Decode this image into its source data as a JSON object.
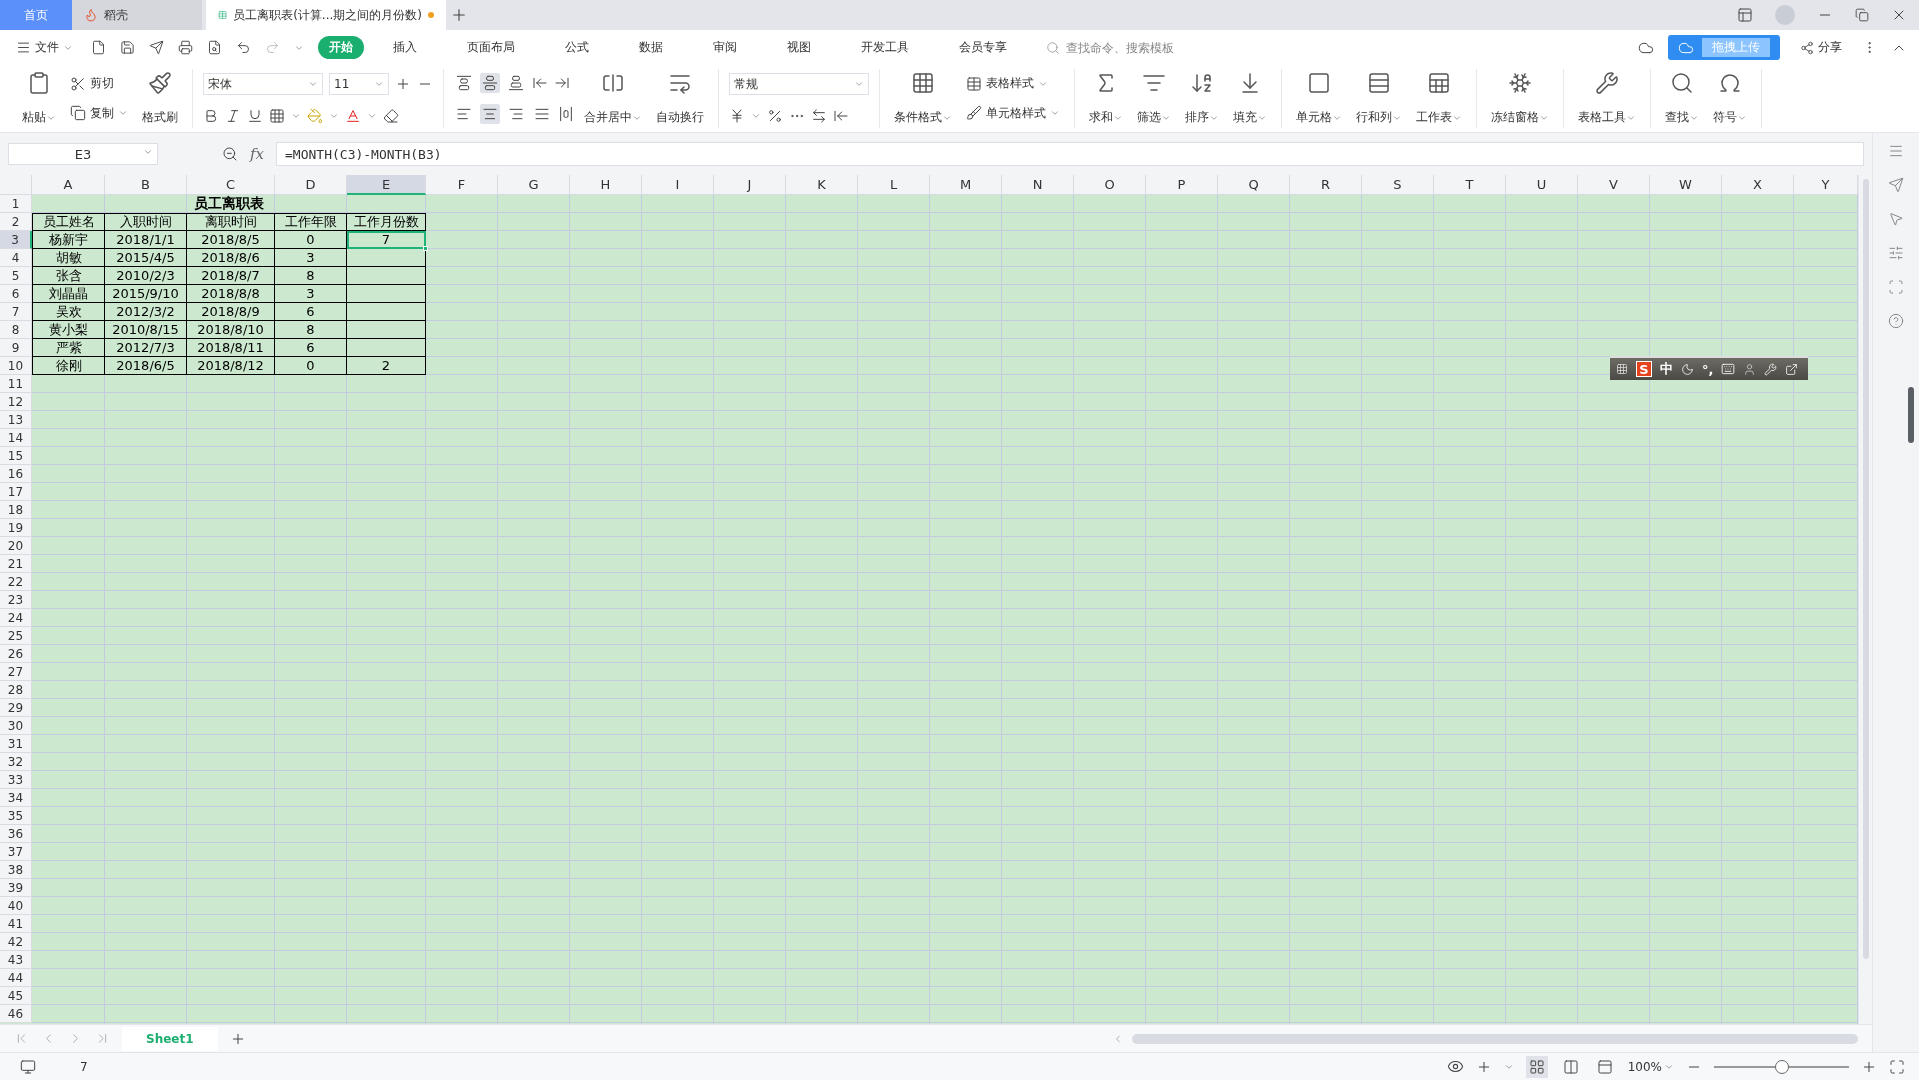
{
  "tabs": [
    {
      "label": "首页",
      "kind": "home",
      "selected": false
    },
    {
      "label": "稻壳",
      "kind": "docer",
      "selected": false
    },
    {
      "label": "员工离职表(计算...期之间的月份数)",
      "kind": "sheet",
      "selected": true,
      "modified": true
    }
  ],
  "menu": {
    "file": "文件",
    "tabs": [
      {
        "label": "开始",
        "selected": true
      },
      {
        "label": "插入",
        "selected": false
      },
      {
        "label": "页面布局",
        "selected": false
      },
      {
        "label": "公式",
        "selected": false
      },
      {
        "label": "数据",
        "selected": false
      },
      {
        "label": "审阅",
        "selected": false
      },
      {
        "label": "视图",
        "selected": false
      },
      {
        "label": "开发工具",
        "selected": false
      },
      {
        "label": "会员专享",
        "selected": false
      }
    ],
    "search": {
      "placeholder": "查找命令、搜索模板"
    },
    "upload": "拖拽上传",
    "share": "分享"
  },
  "ribbon": {
    "groups": [
      {
        "items": [
          {
            "kind": "large",
            "label": "粘贴",
            "dropdown": true
          },
          {
            "kind": "stack",
            "items": [
              {
                "label": "剪切",
                "dropdown": false
              },
              {
                "label": "复制",
                "dropdown": true
              }
            ]
          },
          {
            "kind": "large",
            "label": "格式刷",
            "dropdown": false
          }
        ]
      },
      {
        "items": [
          {
            "kind": "font",
            "font": "宋体",
            "size": "11"
          }
        ]
      },
      {
        "items": [
          {
            "kind": "alignment",
            "vertical": [
              {
                "selected": false
              },
              {
                "selected": true
              },
              {
                "selected": false
              }
            ],
            "horizontal": [
              {
                "selected": false
              },
              {
                "selected": true
              },
              {
                "selected": false
              },
              {
                "selected": false
              }
            ]
          },
          {
            "kind": "large",
            "label": "合并居中",
            "dropdown": true
          },
          {
            "kind": "large",
            "label": "自动换行",
            "dropdown": false
          }
        ]
      },
      {
        "items": [
          {
            "kind": "number",
            "format": "常规"
          }
        ]
      },
      {
        "items": [
          {
            "kind": "large",
            "label": "条件格式",
            "dropdown": true
          },
          {
            "kind": "stack",
            "items": [
              {
                "label": "表格样式",
                "dropdown": true
              },
              {
                "label": "单元格样式",
                "dropdown": true
              }
            ]
          }
        ]
      },
      {
        "items": [
          {
            "kind": "large",
            "label": "求和",
            "dropdown": true
          },
          {
            "kind": "large",
            "label": "筛选",
            "dropdown": true
          },
          {
            "kind": "large",
            "label": "排序",
            "dropdown": true
          },
          {
            "kind": "large",
            "label": "填充",
            "dropdown": true
          }
        ]
      },
      {
        "items": [
          {
            "kind": "large",
            "label": "单元格",
            "dropdown": true
          },
          {
            "kind": "large",
            "label": "行和列",
            "dropdown": true
          },
          {
            "kind": "large",
            "label": "工作表",
            "dropdown": true
          }
        ]
      },
      {
        "items": [
          {
            "kind": "large",
            "label": "冻结窗格",
            "dropdown": true
          }
        ]
      },
      {
        "items": [
          {
            "kind": "large",
            "label": "表格工具",
            "dropdown": true
          }
        ]
      },
      {
        "items": [
          {
            "kind": "large",
            "label": "查找",
            "dropdown": true
          },
          {
            "kind": "large",
            "label": "符号",
            "dropdown": true
          }
        ]
      }
    ]
  },
  "formula_bar": {
    "name_box": "E3",
    "fx": "fx",
    "formula": "=MONTH(C3)-MONTH(B3)"
  },
  "sheet": {
    "columns": [
      {
        "label": "A",
        "selected": false
      },
      {
        "label": "B",
        "selected": false
      },
      {
        "label": "C",
        "selected": false
      },
      {
        "label": "D",
        "selected": false
      },
      {
        "label": "E",
        "selected": true
      },
      {
        "label": "F",
        "selected": false
      },
      {
        "label": "G",
        "selected": false
      },
      {
        "label": "H",
        "selected": false
      },
      {
        "label": "I",
        "selected": false
      },
      {
        "label": "J",
        "selected": false
      },
      {
        "label": "K",
        "selected": false
      },
      {
        "label": "L",
        "selected": false
      },
      {
        "label": "M",
        "selected": false
      },
      {
        "label": "N",
        "selected": false
      },
      {
        "label": "O",
        "selected": false
      },
      {
        "label": "P",
        "selected": false
      },
      {
        "label": "Q",
        "selected": false
      },
      {
        "label": "R",
        "selected": false
      },
      {
        "label": "S",
        "selected": false
      },
      {
        "label": "T",
        "selected": false
      },
      {
        "label": "U",
        "selected": false
      },
      {
        "label": "V",
        "selected": false
      },
      {
        "label": "W",
        "selected": false
      },
      {
        "label": "X",
        "selected": false
      },
      {
        "label": "Y",
        "selected": false
      }
    ],
    "row_numbers": [
      {
        "label": "1",
        "selected": false
      },
      {
        "label": "2",
        "selected": false
      },
      {
        "label": "3",
        "selected": true
      },
      {
        "label": "4",
        "selected": false
      },
      {
        "label": "5",
        "selected": false
      },
      {
        "label": "6",
        "selected": false
      },
      {
        "label": "7",
        "selected": false
      },
      {
        "label": "8",
        "selected": false
      },
      {
        "label": "9",
        "selected": false
      },
      {
        "label": "10",
        "selected": false
      },
      {
        "label": "11",
        "selected": false
      },
      {
        "label": "12",
        "selected": false
      },
      {
        "label": "13",
        "selected": false
      },
      {
        "label": "14",
        "selected": false
      },
      {
        "label": "15",
        "selected": false
      },
      {
        "label": "16",
        "selected": false
      },
      {
        "label": "17",
        "selected": false
      },
      {
        "label": "18",
        "selected": false
      },
      {
        "label": "19",
        "selected": false
      },
      {
        "label": "20",
        "selected": false
      },
      {
        "label": "21",
        "selected": false
      },
      {
        "label": "22",
        "selected": false
      },
      {
        "label": "23",
        "selected": false
      },
      {
        "label": "24",
        "selected": false
      },
      {
        "label": "25",
        "selected": false
      },
      {
        "label": "26",
        "selected": false
      },
      {
        "label": "27",
        "selected": false
      },
      {
        "label": "28",
        "selected": false
      },
      {
        "label": "29",
        "selected": false
      },
      {
        "label": "30",
        "selected": false
      },
      {
        "label": "31",
        "selected": false
      },
      {
        "label": "32",
        "selected": false
      },
      {
        "label": "33",
        "selected": false
      },
      {
        "label": "34",
        "selected": false
      },
      {
        "label": "35",
        "selected": false
      },
      {
        "label": "36",
        "selected": false
      },
      {
        "label": "37",
        "selected": false
      },
      {
        "label": "38",
        "selected": false
      },
      {
        "label": "39",
        "selected": false
      },
      {
        "label": "40",
        "selected": false
      },
      {
        "label": "41",
        "selected": false
      },
      {
        "label": "42",
        "selected": false
      },
      {
        "label": "43",
        "selected": false
      },
      {
        "label": "44",
        "selected": false
      },
      {
        "label": "45",
        "selected": false
      },
      {
        "label": "46",
        "selected": false
      }
    ],
    "title": "员工离职表",
    "headers": [
      "员工姓名",
      "入职时间",
      "离职时间",
      "工作年限",
      "工作月份数"
    ],
    "records": [
      {
        "name": "杨新宇",
        "hired": "2018/1/1",
        "left": "2018/8/5",
        "years": "0",
        "months": "7"
      },
      {
        "name": "胡敏",
        "hired": "2015/4/5",
        "left": "2018/8/6",
        "years": "3"
      },
      {
        "name": "张含",
        "hired": "2010/2/3",
        "left": "2018/8/7",
        "years": "8"
      },
      {
        "name": "刘晶晶",
        "hired": "2015/9/10",
        "left": "2018/8/8",
        "years": "3"
      },
      {
        "name": "吴欢",
        "hired": "2012/3/2",
        "left": "2018/8/9",
        "years": "6"
      },
      {
        "name": "黄小梨",
        "hired": "2010/8/15",
        "left": "2018/8/10",
        "years": "8"
      },
      {
        "name": "严紫",
        "hired": "2012/7/3",
        "left": "2018/8/11",
        "years": "6"
      },
      {
        "name": "徐刚",
        "hired": "2018/6/5",
        "left": "2018/8/12",
        "years": "0",
        "months": "2"
      }
    ]
  },
  "sheet_tabs": [
    {
      "label": "Sheet1",
      "selected": true
    }
  ],
  "ime_bar": {
    "logo": "S",
    "mode": "中",
    "punctuation": "°,"
  },
  "status_bar": {
    "cell_value": "7",
    "zoom": "100%",
    "zoom_slider": {
      "level": 0.5
    },
    "views": [
      {
        "kind": "normal",
        "selected": true
      },
      {
        "kind": "page",
        "selected": false
      },
      {
        "kind": "break",
        "selected": false
      }
    ]
  }
}
